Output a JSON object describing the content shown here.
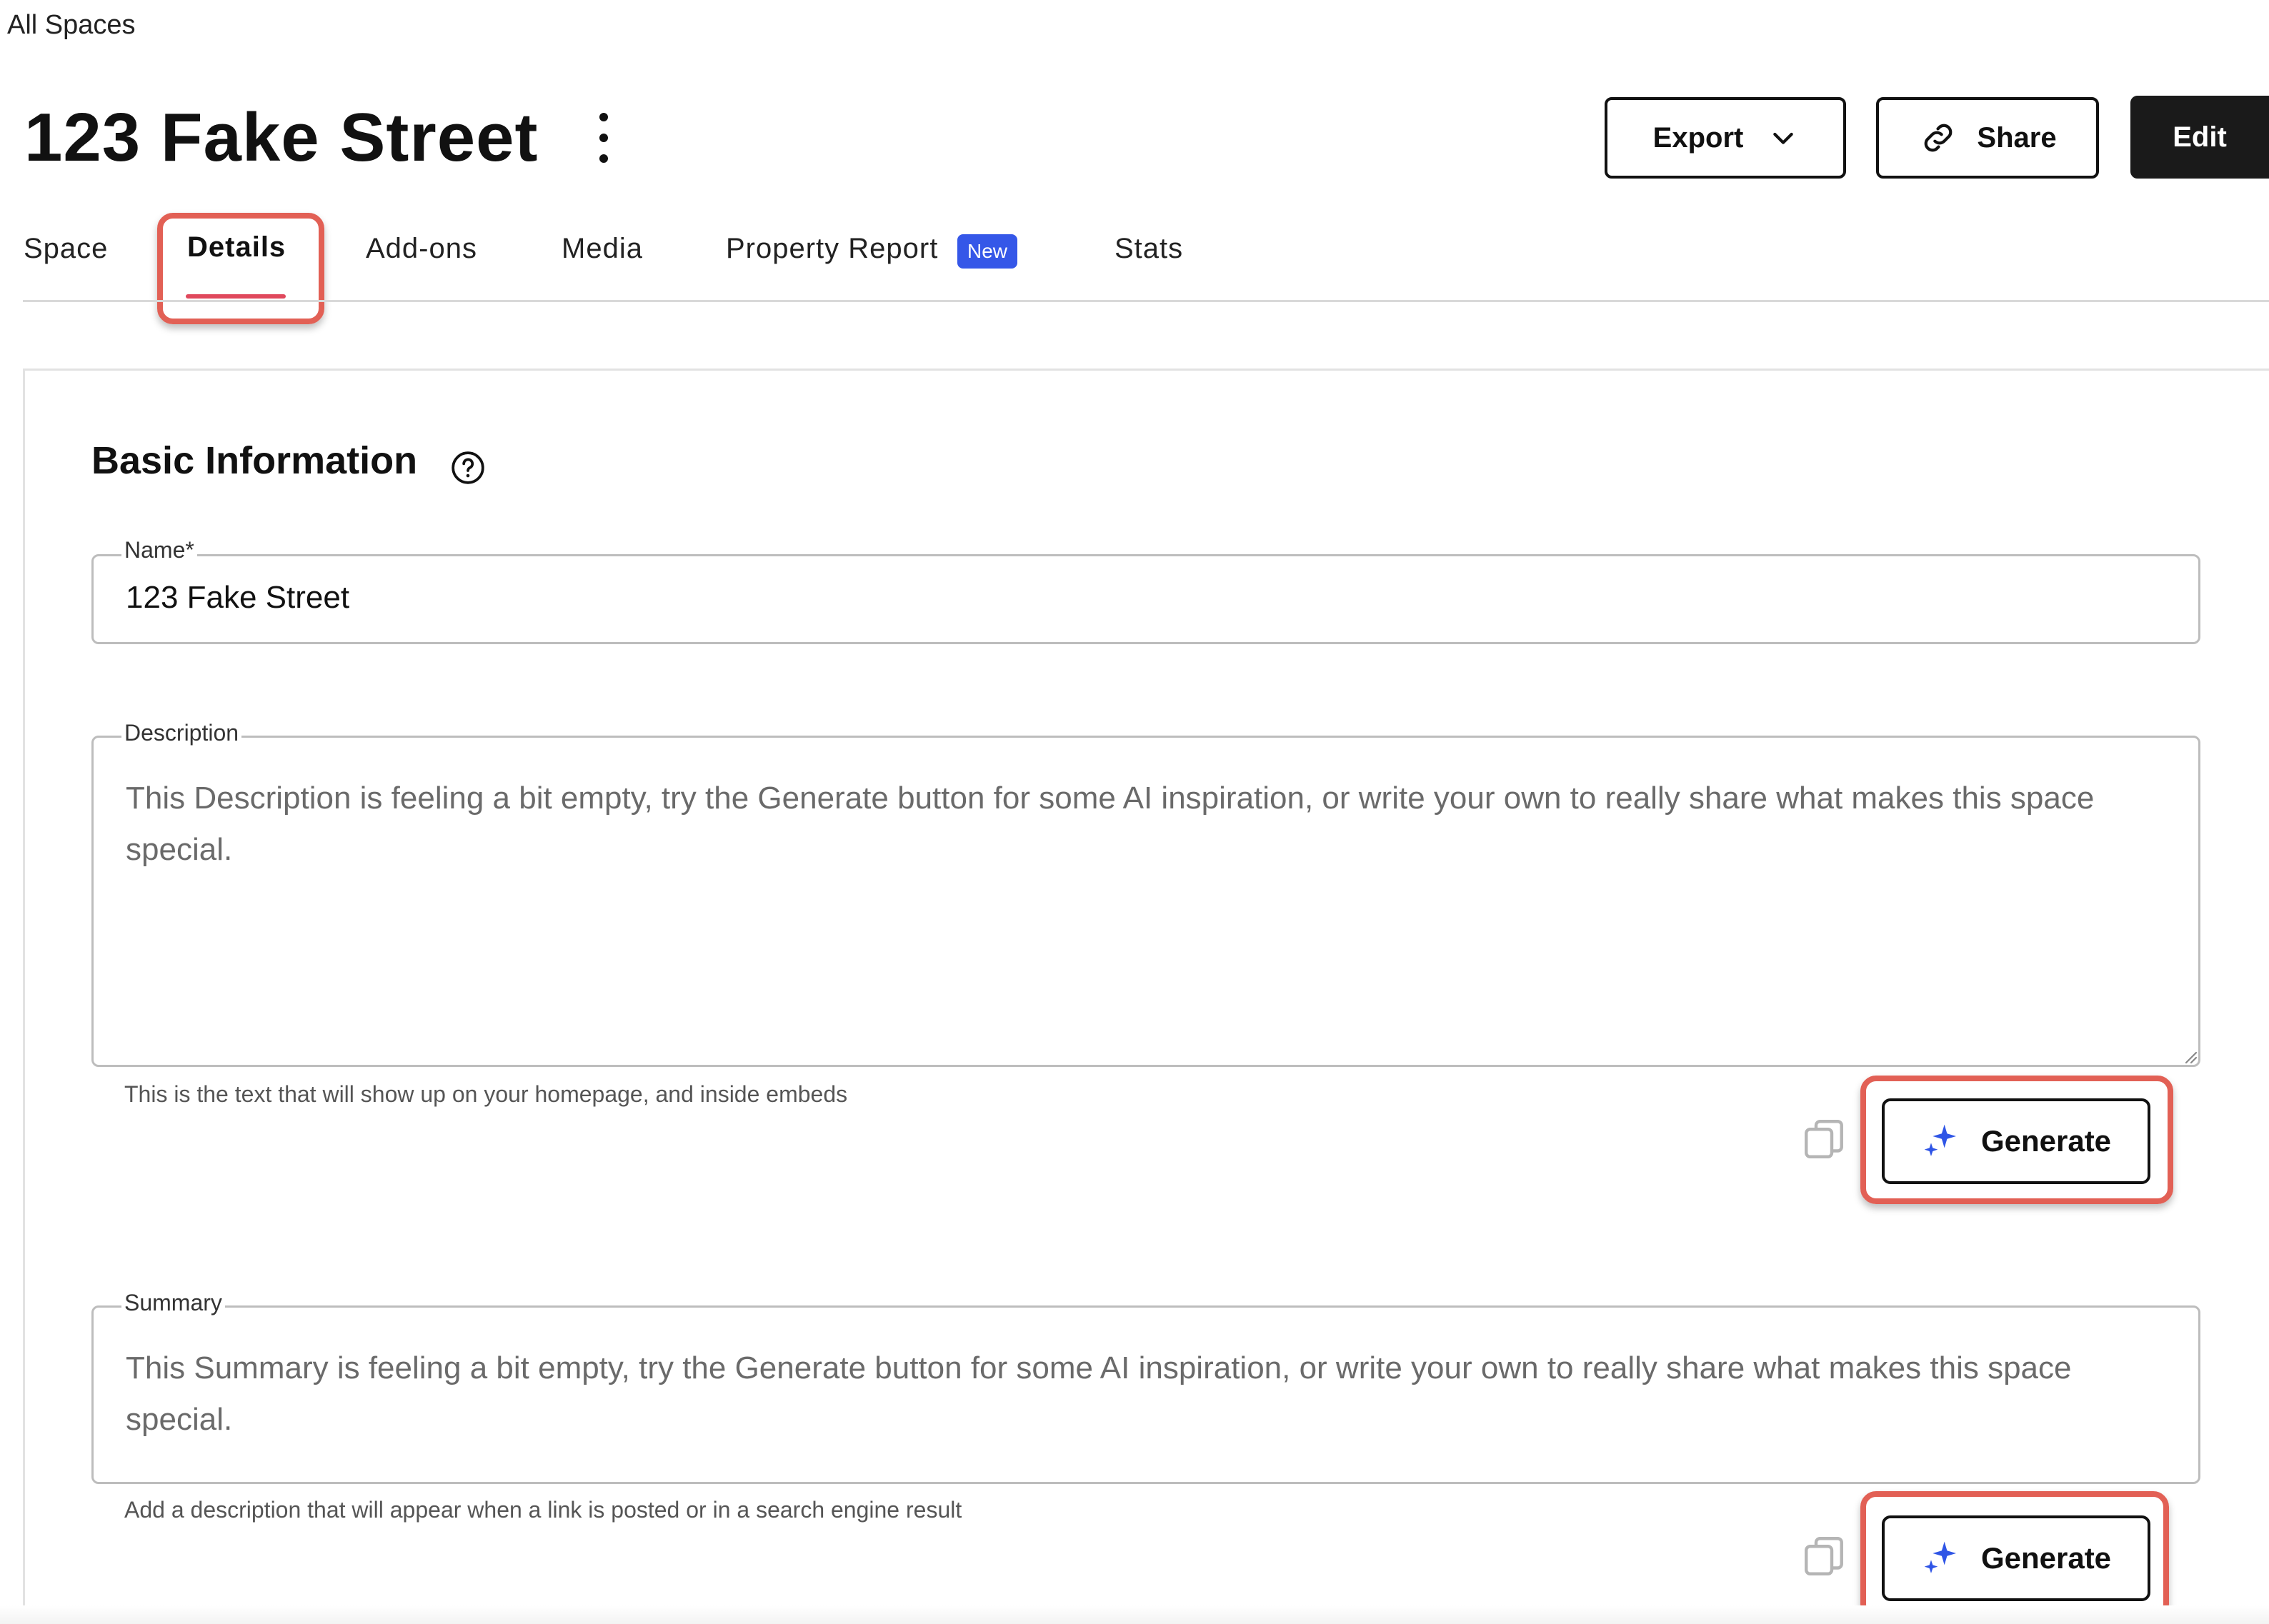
{
  "breadcrumb": "All Spaces",
  "page_title": "123 Fake Street",
  "header_actions": {
    "export_label": "Export",
    "share_label": "Share",
    "edit_label": "Edit"
  },
  "tabs": [
    {
      "label": "Space"
    },
    {
      "label": "Details",
      "active": true
    },
    {
      "label": "Add-ons"
    },
    {
      "label": "Media"
    },
    {
      "label": "Property Report",
      "badge": "New"
    },
    {
      "label": "Stats"
    }
  ],
  "section": {
    "title": "Basic Information"
  },
  "fields": {
    "name": {
      "label": "Name*",
      "value": "123 Fake Street"
    },
    "description": {
      "label": "Description",
      "placeholder": "This Description is feeling a bit empty, try the Generate button for some AI inspiration, or write your own to really share what makes this space special.",
      "hint": "This is the text that will show up on your homepage, and inside embeds",
      "generate_label": "Generate"
    },
    "summary": {
      "label": "Summary",
      "placeholder": "This Summary is feeling a bit empty, try the Generate button for some AI inspiration, or write your own to really share what makes this space special.",
      "hint": "Add a description that will appear when a link is posted or in a search engine result",
      "generate_label": "Generate"
    }
  },
  "icons": {
    "kebab": "more-vertical-icon",
    "export_chevron": "chevron-down-icon",
    "share": "link-icon",
    "help": "help-circle-icon",
    "copy": "copy-icon",
    "generate": "sparkle-icon"
  },
  "colors": {
    "accent_badge": "#3557e8",
    "active_tab_underline": "#e0485c",
    "annotation_highlight": "#e26055",
    "sparkle": "#2f55e6"
  }
}
